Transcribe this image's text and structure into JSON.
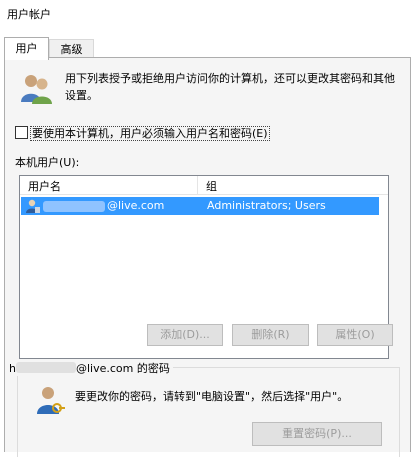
{
  "window": {
    "title": "用户帐户"
  },
  "tabs": [
    {
      "label": "用户",
      "active": true
    },
    {
      "label": "高级",
      "active": false
    }
  ],
  "intro": {
    "icon": "users-icon",
    "text": "用下列表授予或拒绝用户访问你的计算机，还可以更改其密码和其他设置。"
  },
  "require_login": {
    "checked": false,
    "label": "要使用本计算机，用户必须输入用户名和密码(E)"
  },
  "local_users": {
    "label": "本机用户(U):",
    "columns": [
      "用户名",
      "组"
    ],
    "rows": [
      {
        "username": "@live.com",
        "group": "Administrators; Users",
        "selected": true,
        "icon": "user-icon"
      }
    ]
  },
  "buttons": {
    "add": "添加(D)...",
    "remove": "删除(R)",
    "properties": "属性(O)",
    "reset_password": "重置密码(P)..."
  },
  "password_section": {
    "title_prefix": "h",
    "title_suffix": "@live.com 的密码",
    "icon": "key-user-icon",
    "text": "要更改你的密码，请转到\"电脑设置\"，然后选择\"用户\"。"
  },
  "colors": {
    "selection": "#3399ff",
    "disabled_text": "#9c9c9c",
    "panel_bg": "#f5f5f5"
  }
}
